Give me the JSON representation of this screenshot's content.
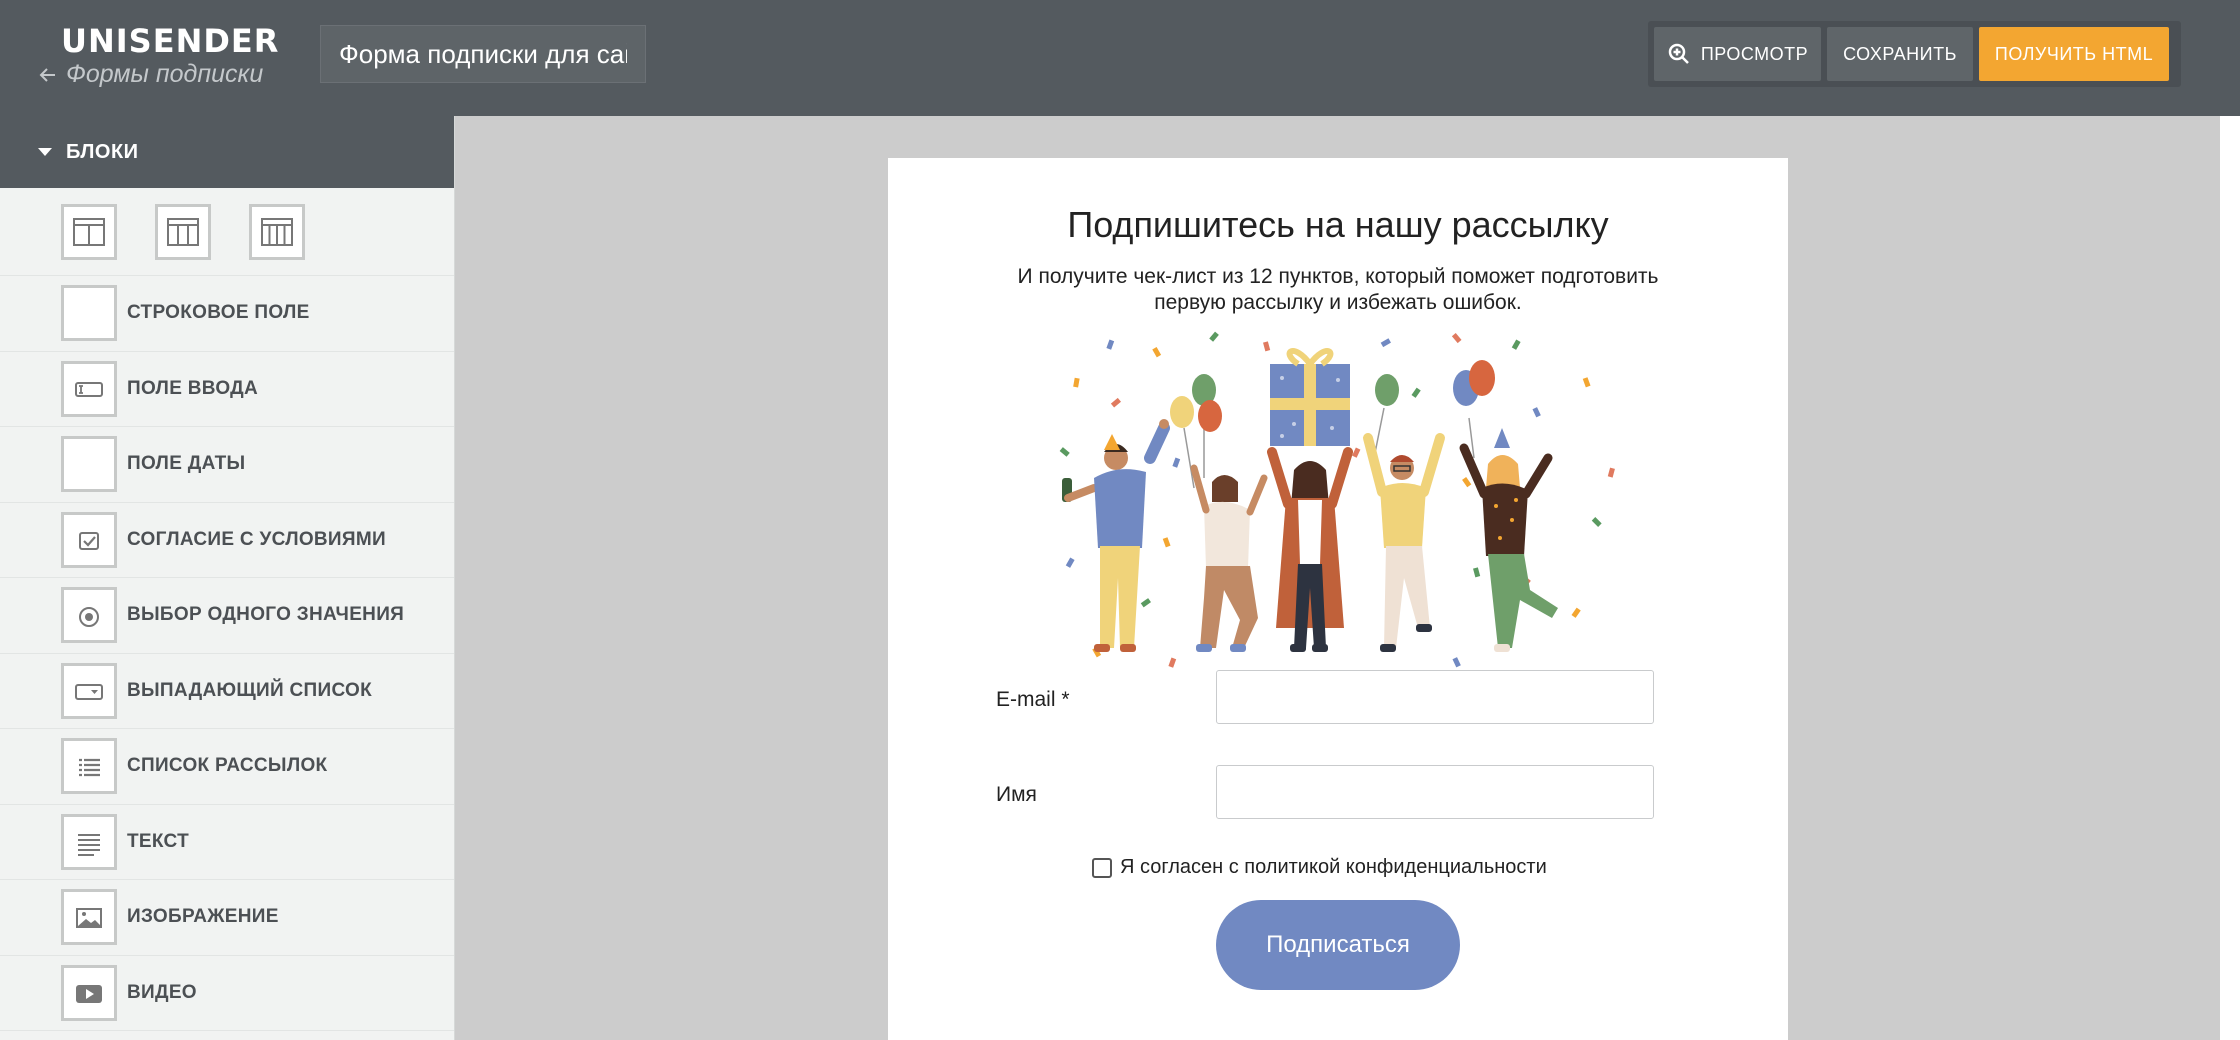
{
  "header": {
    "logo": "UNISENDER",
    "back_link": "Формы подписки",
    "form_name": "Форма подписки для сайта",
    "preview_label": "ПРОСМОТР",
    "save_label": "СОХРАНИТЬ",
    "get_html_label": "ПОЛУЧИТЬ HTML",
    "accent_color": "#f3a631"
  },
  "sidebar": {
    "section_title": "БЛОКИ",
    "column_layouts": [
      "2-columns",
      "3-columns",
      "4-columns"
    ],
    "items": [
      {
        "label": "СТРОКОВОЕ ПОЛЕ",
        "icon": "blank-field-icon"
      },
      {
        "label": "ПОЛЕ ВВОДА",
        "icon": "text-input-icon"
      },
      {
        "label": "ПОЛЕ ДАТЫ",
        "icon": "blank-field-icon"
      },
      {
        "label": "СОГЛАСИЕ С УСЛОВИЯМИ",
        "icon": "checkbox-icon"
      },
      {
        "label": "ВЫБОР ОДНОГО ЗНАЧЕНИЯ",
        "icon": "radio-icon"
      },
      {
        "label": "ВЫПАДАЮЩИЙ СПИСОК",
        "icon": "dropdown-icon"
      },
      {
        "label": "СПИСОК РАССЫЛОК",
        "icon": "list-icon"
      },
      {
        "label": "ТЕКСТ",
        "icon": "text-lines-icon"
      },
      {
        "label": "ИЗОБРАЖЕНИЕ",
        "icon": "image-icon"
      },
      {
        "label": "ВИДЕО",
        "icon": "video-icon"
      }
    ]
  },
  "form": {
    "title": "Подпишитесь на нашу рассылку",
    "subtitle": "И получите чек-лист из 12 пунктов, который поможет подготовить первую рассылку и избежать ошибок.",
    "email_label": "E-mail *",
    "name_label": "Имя",
    "consent_label": "Я согласен с политикой конфиденциальности",
    "submit_label": "Подписаться",
    "submit_color": "#7189c2"
  }
}
